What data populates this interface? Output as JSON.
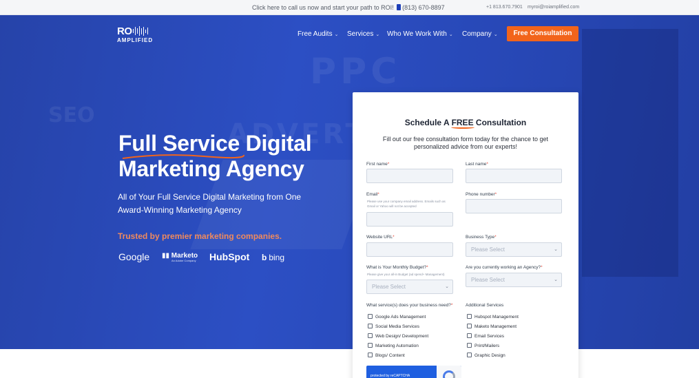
{
  "topbar": {
    "cta_prefix": "Click here to call us now and start your path to ROI!",
    "cta_phone": "(813) 670-8897",
    "phone_small": "+1 813.670.7901",
    "email": "myroi@roiamplified.com"
  },
  "bg": {
    "word1": "PPC",
    "word2": "ADVERT",
    "word3": "SEO"
  },
  "logo": {
    "line1": "RO",
    "line2": "AMPLIFIED"
  },
  "nav": {
    "items": [
      {
        "label": "Free Audits"
      },
      {
        "label": "Services"
      },
      {
        "label": "Who We Work With"
      },
      {
        "label": "Company"
      }
    ],
    "cta": "Free Consultation"
  },
  "hero": {
    "headline_line1": "Full Service Digital",
    "headline_line2": "Marketing Agency",
    "subhead": "All of Your Full Service Digital Marketing from One Award-Winning Marketing Agency",
    "trusted": "Trusted by premier marketing companies.",
    "brands": {
      "google": "Google",
      "marketo": "Marketo",
      "marketo_sub": "An Adobe Company",
      "hubspot": "HubSpot",
      "bing": "bing"
    }
  },
  "form": {
    "title_pre": "Schedule A",
    "title_free": "FREE",
    "title_post": "Consultation",
    "description": "Fill out our free consultation form today for the chance to get personalized advice from our experts!",
    "first_name_label": "First name",
    "last_name_label": "Last name",
    "email_label": "Email",
    "email_hint": "Please use your company email address. Emails such as Gmail or Yahoo will not be accepted",
    "phone_label": "Phone number",
    "website_label": "Website URL",
    "business_type_label": "Business Type",
    "business_type_value": "Please Select",
    "budget_label": "What is Your Monthly  Budget?",
    "budget_hint": "Please give your all-in Budget (ad spend+ Management)",
    "budget_value": "Please Select",
    "agency_label": "Are you currently working an Agency?",
    "agency_value": "Please Select",
    "services_label": "What service(s) does your business need?",
    "additional_label": "Additional Services",
    "services": [
      "Google Ads Management",
      "Social Media Services",
      "Web Design/ Development",
      "Marketing Automation",
      "Blogs/ Content"
    ],
    "additional": [
      "Hubspot Management",
      "Maketo Management",
      "Email Services",
      "Print/Mailers",
      "Graphic Design"
    ],
    "recaptcha_text": "protected by reCAPTCHA"
  },
  "colors": {
    "hero_blue": "#2c4fc4",
    "accent_orange": "#f2641b",
    "trusted_orange": "#f08a5d"
  }
}
